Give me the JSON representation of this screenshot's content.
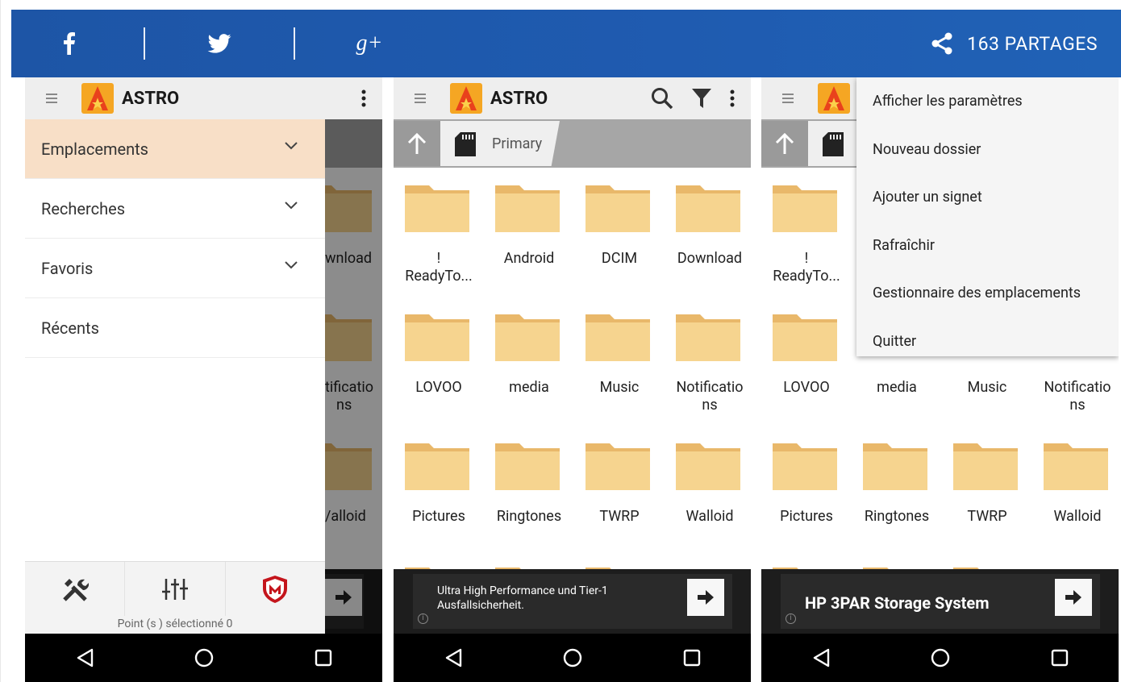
{
  "share_bar": {
    "facebook_icon": "facebook-f-icon",
    "twitter_icon": "twitter-bird-icon",
    "gplus_icon": "google-plus-icon",
    "gplus_label": "g+",
    "share_count": "163 PARTAGES",
    "color": "#1f5bb0"
  },
  "app": {
    "name": "ASTRO",
    "accent": "#f4a024"
  },
  "phone1": {
    "drawer_items": [
      {
        "label": "Emplacements",
        "expandable": true,
        "selected": true
      },
      {
        "label": "Recherches",
        "expandable": true,
        "selected": false
      },
      {
        "label": "Favoris",
        "expandable": true,
        "selected": false
      },
      {
        "label": "Récents",
        "expandable": false,
        "selected": false
      }
    ],
    "peek_labels": [
      "wnload",
      "tificatio",
      "ns",
      "/alloid"
    ],
    "status": "Point (s ) sélectionné 0"
  },
  "path": {
    "current": "Primary"
  },
  "folders_row1": [
    "!",
    "Android",
    "DCIM",
    "Download"
  ],
  "folders_row1_sub": [
    "ReadyTo...",
    "",
    "",
    ""
  ],
  "folders_row2": [
    "LOVOO",
    "media",
    "Music",
    "Notificatio"
  ],
  "folders_row2_sub": [
    "",
    "",
    "",
    "ns"
  ],
  "folders_row3": [
    "Pictures",
    "Ringtones",
    "TWRP",
    "Walloid"
  ],
  "phone2": {
    "ad_line1": "Ultra High Performance und Tier-1",
    "ad_line2": "Ausfallsicherheit."
  },
  "phone3": {
    "menu_items": [
      "Afficher les paramètres",
      "Nouveau dossier",
      "Ajouter un signet",
      "Rafraîchir",
      "Gestionnaire des emplacements",
      "Quitter"
    ],
    "ad_text": "HP 3PAR Storage System"
  },
  "nav": {
    "back": "back-triangle-icon",
    "home": "home-circle-icon",
    "recents": "recents-square-icon"
  }
}
